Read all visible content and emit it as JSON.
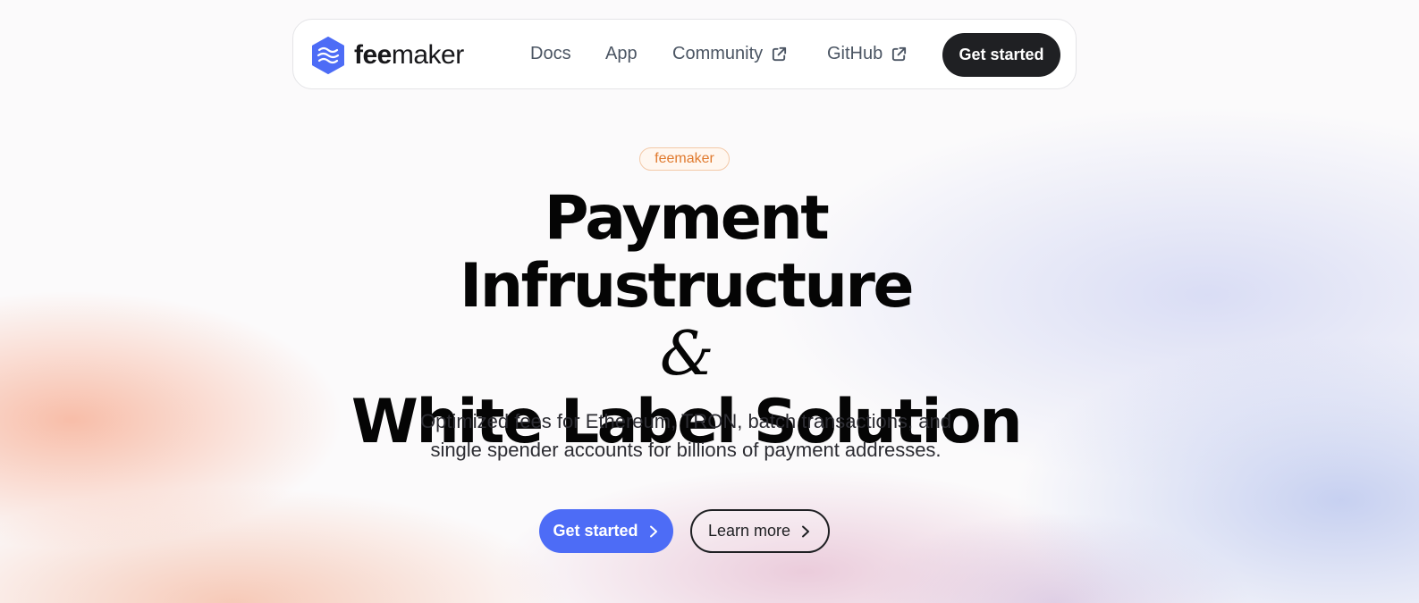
{
  "nav": {
    "brand_bold": "fee",
    "brand_light": "maker",
    "links": [
      {
        "label": "Docs",
        "external": false
      },
      {
        "label": "App",
        "external": false
      },
      {
        "label": "Community",
        "external": true
      },
      {
        "label": "GitHub",
        "external": true
      }
    ],
    "cta_label": "Get started"
  },
  "hero": {
    "badge": "feemaker",
    "title_line1": "Payment",
    "title_line2": "Infrustructure",
    "title_amp": "&",
    "title_line3": "White Label Solution",
    "subtitle_line1": "Optimized fees for Ethereum, TRON, batch transactions, and",
    "subtitle_line2": "single spender accounts for billions of payment addresses.",
    "primary_button": "Get started",
    "secondary_button": "Learn more"
  },
  "icons": {
    "logo": "hexagon-waves-logo-icon",
    "external_link": "external-link-icon",
    "chevron": "chevron-right-icon"
  },
  "colors": {
    "accent": "#4d6cf6",
    "dark": "#1f2023",
    "badge_text": "#e07a2e"
  }
}
